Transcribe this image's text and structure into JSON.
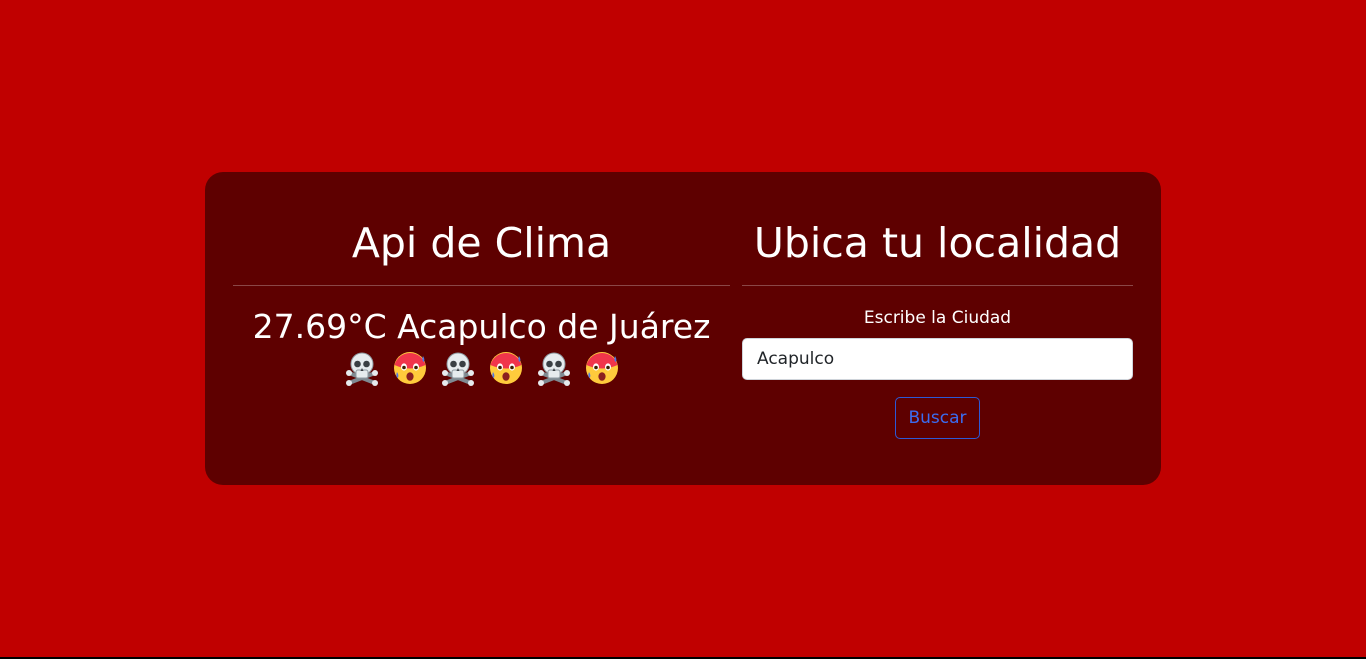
{
  "left": {
    "title": "Api de Clima",
    "weather_text": "27.69°C Acapulco de Juárez",
    "emojis": [
      "skull-crossbones-icon",
      "hot-face-icon",
      "skull-crossbones-icon",
      "hot-face-icon",
      "skull-crossbones-icon",
      "hot-face-icon"
    ]
  },
  "right": {
    "title": "Ubica tu localidad",
    "label": "Escribe la Ciudad",
    "input_value": "Acapulco",
    "button_label": "Buscar"
  },
  "colors": {
    "background": "#c00000",
    "card": "#5e0000",
    "button_accent": "#3b6cf0"
  }
}
